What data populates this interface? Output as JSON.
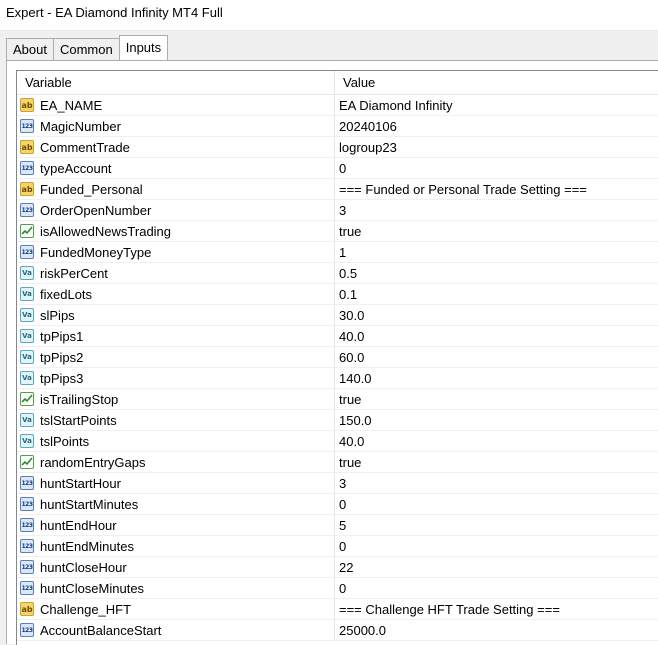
{
  "window": {
    "title": "Expert - EA Diamond Infinity MT4 Full"
  },
  "tabs": [
    {
      "label": "About",
      "active": false
    },
    {
      "label": "Common",
      "active": false
    },
    {
      "label": "Inputs",
      "active": true
    }
  ],
  "table": {
    "columns": {
      "variable": "Variable",
      "value": "Value"
    },
    "rows": [
      {
        "type": "ab",
        "icon": "string-icon",
        "name": "EA_NAME",
        "value": "EA Diamond Infinity"
      },
      {
        "type": "num",
        "icon": "integer-icon",
        "name": "MagicNumber",
        "value": "20240106"
      },
      {
        "type": "ab",
        "icon": "string-icon",
        "name": "CommentTrade",
        "value": "logroup23"
      },
      {
        "type": "num",
        "icon": "integer-icon",
        "name": "typeAccount",
        "value": "0"
      },
      {
        "type": "ab",
        "icon": "string-icon",
        "name": "Funded_Personal",
        "value": "=== Funded or Personal Trade Setting ==="
      },
      {
        "type": "num",
        "icon": "integer-icon",
        "name": "OrderOpenNumber",
        "value": "3"
      },
      {
        "type": "bool",
        "icon": "boolean-icon",
        "name": "isAllowedNewsTrading",
        "value": "true"
      },
      {
        "type": "num",
        "icon": "integer-icon",
        "name": "FundedMoneyType",
        "value": "1"
      },
      {
        "type": "dbl",
        "icon": "double-icon",
        "name": "riskPerCent",
        "value": "0.5"
      },
      {
        "type": "dbl",
        "icon": "double-icon",
        "name": "fixedLots",
        "value": "0.1"
      },
      {
        "type": "dbl",
        "icon": "double-icon",
        "name": "slPips",
        "value": "30.0"
      },
      {
        "type": "dbl",
        "icon": "double-icon",
        "name": "tpPips1",
        "value": "40.0"
      },
      {
        "type": "dbl",
        "icon": "double-icon",
        "name": "tpPips2",
        "value": "60.0"
      },
      {
        "type": "dbl",
        "icon": "double-icon",
        "name": "tpPips3",
        "value": "140.0"
      },
      {
        "type": "bool",
        "icon": "boolean-icon",
        "name": "isTrailingStop",
        "value": "true"
      },
      {
        "type": "dbl",
        "icon": "double-icon",
        "name": "tslStartPoints",
        "value": "150.0"
      },
      {
        "type": "dbl",
        "icon": "double-icon",
        "name": "tslPoints",
        "value": "40.0"
      },
      {
        "type": "bool",
        "icon": "boolean-icon",
        "name": "randomEntryGaps",
        "value": "true"
      },
      {
        "type": "num",
        "icon": "integer-icon",
        "name": "huntStartHour",
        "value": "3"
      },
      {
        "type": "num",
        "icon": "integer-icon",
        "name": "huntStartMinutes",
        "value": "0"
      },
      {
        "type": "num",
        "icon": "integer-icon",
        "name": "huntEndHour",
        "value": "5"
      },
      {
        "type": "num",
        "icon": "integer-icon",
        "name": "huntEndMinutes",
        "value": "0"
      },
      {
        "type": "num",
        "icon": "integer-icon",
        "name": "huntCloseHour",
        "value": "22"
      },
      {
        "type": "num",
        "icon": "integer-icon",
        "name": "huntCloseMinutes",
        "value": "0"
      },
      {
        "type": "ab",
        "icon": "string-icon",
        "name": "Challenge_HFT",
        "value": "=== Challenge HFT Trade Setting ==="
      },
      {
        "type": "num",
        "icon": "integer-icon",
        "name": "AccountBalanceStart",
        "value": "25000.0"
      }
    ]
  }
}
